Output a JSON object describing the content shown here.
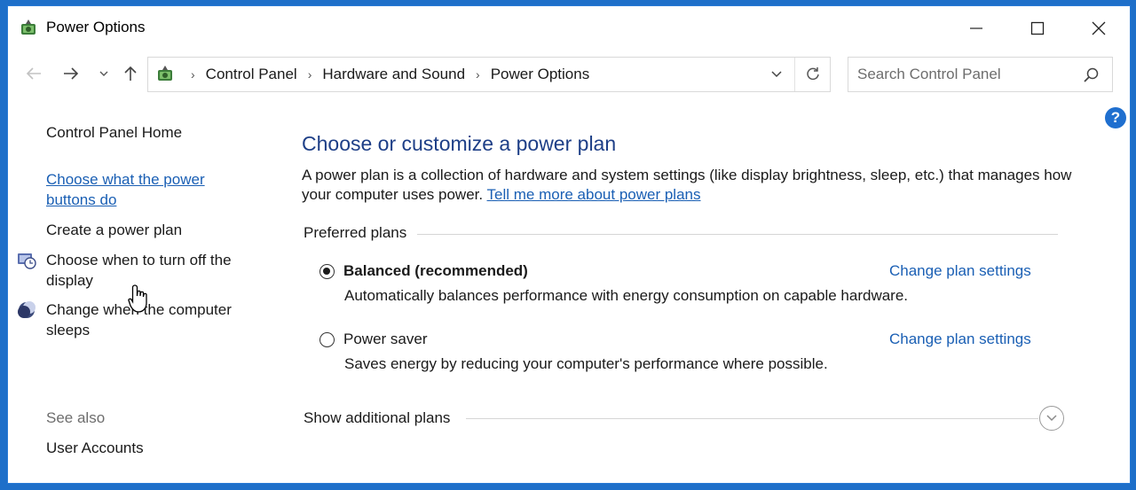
{
  "window": {
    "title": "Power Options",
    "app_icon": "power-options-icon",
    "controls": [
      "minimize-icon",
      "maximize-icon",
      "close-icon"
    ]
  },
  "nav": {
    "back_icon": "arrow-left-icon",
    "forward_icon": "arrow-right-icon",
    "recent_icon": "chevron-down-icon",
    "up_icon": "arrow-up-icon",
    "breadcrumbs": [
      "Control Panel",
      "Hardware and Sound",
      "Power Options"
    ],
    "refresh_icon": "refresh-icon"
  },
  "search": {
    "placeholder": "Search Control Panel",
    "icon": "search-icon"
  },
  "help_label": "?",
  "sidebar": {
    "home": "Control Panel Home",
    "links": [
      {
        "label_line1": "Choose what the power",
        "label_line2": "buttons do",
        "hovered": true
      },
      {
        "label_line1": "Create a power plan"
      },
      {
        "label_line1": "Choose when to turn off the",
        "label_line2": "display",
        "icon": "display-timer-icon"
      },
      {
        "label_line1": "Change when the computer",
        "label_line2": "sleeps",
        "icon": "moon-icon"
      }
    ],
    "see_also": "See also",
    "user_accounts": "User Accounts"
  },
  "main": {
    "heading": "Choose or customize a power plan",
    "description": "A power plan is a collection of hardware and system settings (like display brightness, sleep, etc.) that manages how your computer uses power.",
    "description_link": "Tell me more about power plans",
    "preferred_title": "Preferred plans",
    "plans": [
      {
        "name": "Balanced (recommended)",
        "selected": true,
        "change_label": "Change plan settings",
        "description": "Automatically balances performance with energy consumption on capable hardware."
      },
      {
        "name": "Power saver",
        "selected": false,
        "change_label": "Change plan settings",
        "description": "Saves energy by reducing your computer's performance where possible."
      }
    ],
    "additional_title": "Show additional plans",
    "expand_icon": "chevron-down-circle-icon"
  },
  "colors": {
    "accent": "#1a5fb4",
    "heading": "#1e3f87",
    "desktop": "#1e6fc9"
  }
}
